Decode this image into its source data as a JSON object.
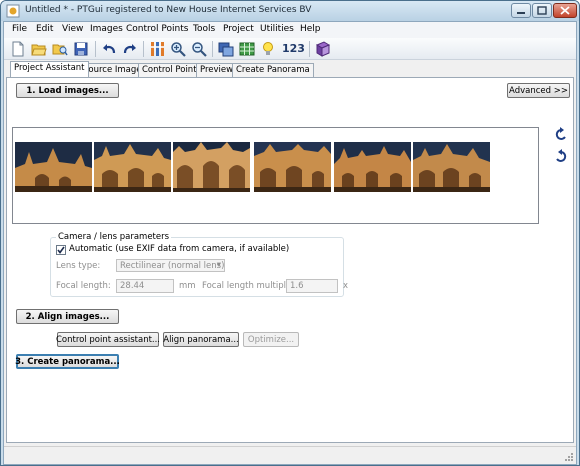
{
  "window": {
    "title": "Untitled * - PTGui registered to New House Internet Services BV"
  },
  "menu": [
    "File",
    "Edit",
    "View",
    "Images",
    "Control Points",
    "Tools",
    "Project",
    "Utilities",
    "Help"
  ],
  "toolbar": {
    "icons": [
      "new-project",
      "open-project",
      "save-project",
      "undo",
      "redo",
      "control-point-table",
      "zoom-in",
      "zoom-out",
      "panorama-editor",
      "grid",
      "tips-lightbulb",
      "numbering",
      "help-book"
    ],
    "numbering_text": "123"
  },
  "tabs": [
    "Project Assistant",
    "Source Images",
    "Control Points",
    "Preview",
    "Create Panorama"
  ],
  "active_tab": "Project Assistant",
  "assistant": {
    "load_images_label": "1. Load images...",
    "advanced_label": "Advanced >>",
    "thumbnails_count": 6,
    "camera_group_title": "Camera / lens parameters",
    "automatic_checked": true,
    "automatic_label": "Automatic (use EXIF data from camera, if available)",
    "lens_type_label": "Lens type:",
    "lens_type_value": "Rectilinear (normal lens)",
    "focal_length_label": "Focal length:",
    "focal_length_value": "28.44",
    "focal_length_unit": "mm",
    "multiplier_label": "Focal length multiplier:",
    "multiplier_value": "1.6",
    "multiplier_unit": "x",
    "align_images_label": "2. Align images...",
    "cp_assistant_label": "Control point assistant...",
    "align_panorama_label": "Align panorama...",
    "optimize_label": "Optimize...",
    "create_panorama_label": "3. Create panorama..."
  },
  "colors": {
    "title_bar": "#c9dcea",
    "close_button": "#c2432b",
    "default_button_border": "#3c7fb1",
    "sky": "#1e2c44",
    "facade": "#c58b48"
  }
}
